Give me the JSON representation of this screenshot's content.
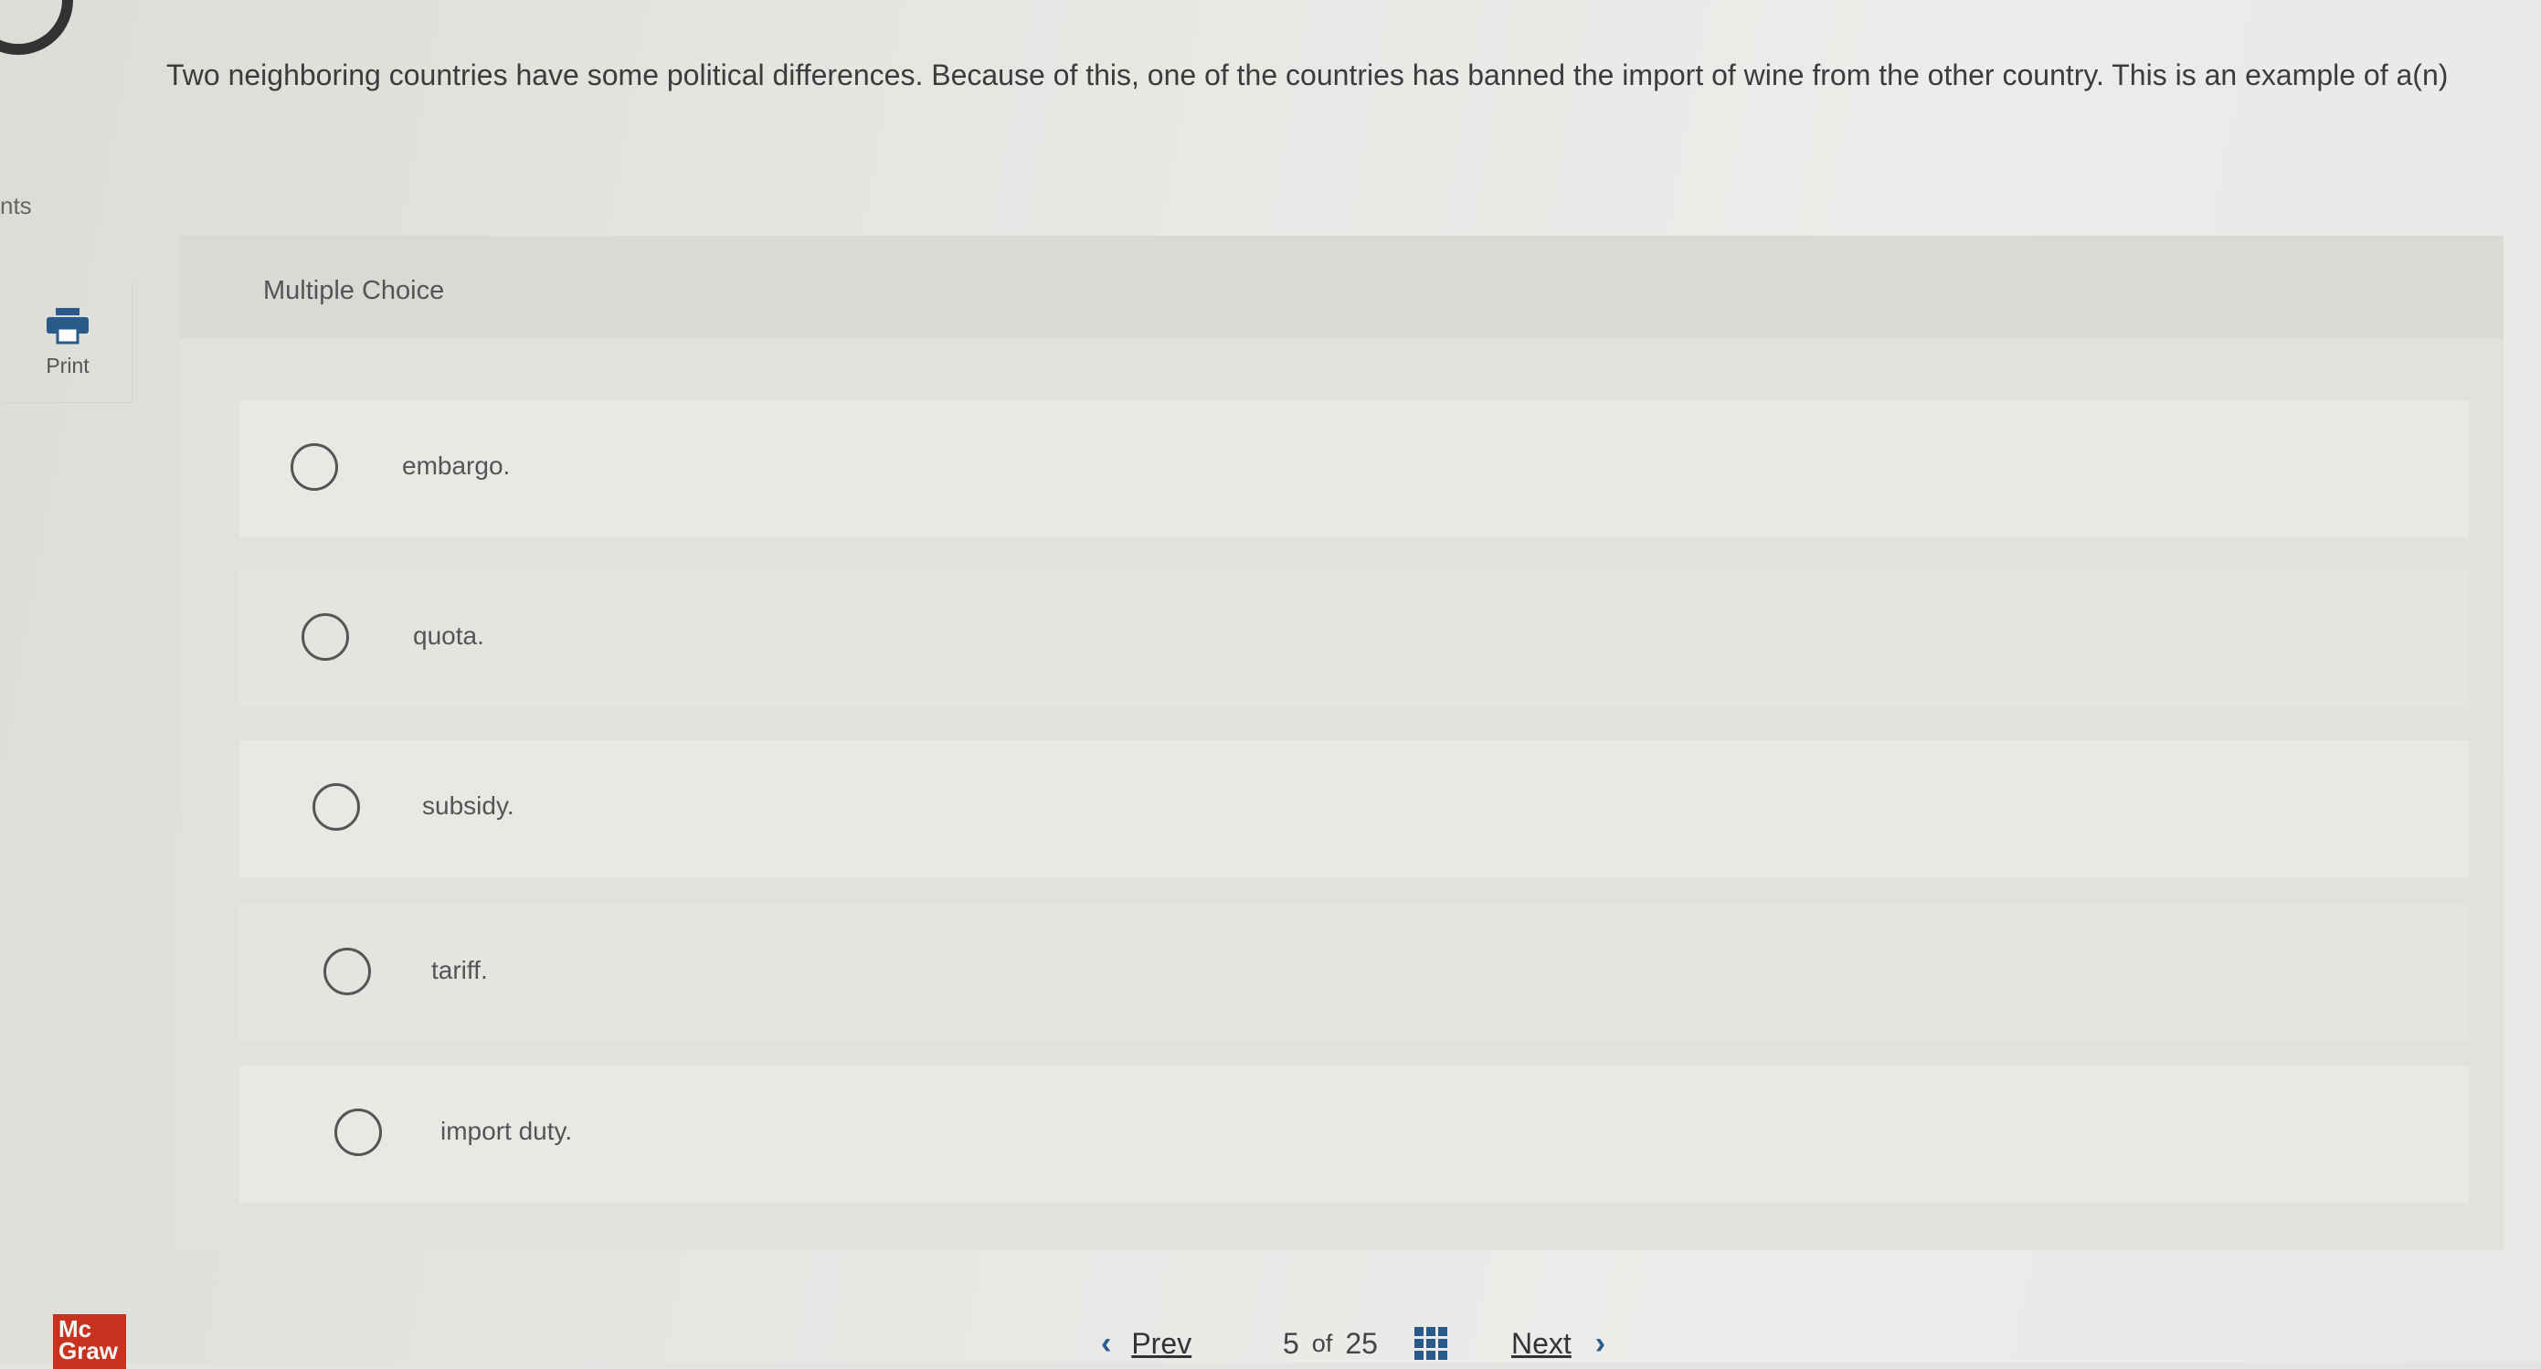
{
  "sidebar": {
    "nav_fragment": "nts",
    "print_label": "Print"
  },
  "question": {
    "text": "Two neighboring countries have some political differences. Because of this, one of the countries has banned the import of wine from the other country. This is an example of a(n)"
  },
  "multiple_choice": {
    "title": "Multiple Choice",
    "choices": [
      {
        "label": "embargo."
      },
      {
        "label": "quota."
      },
      {
        "label": "subsidy."
      },
      {
        "label": "tariff."
      },
      {
        "label": "import duty."
      }
    ]
  },
  "footer": {
    "logo_line1": "Mc",
    "logo_line2": "Graw",
    "prev_label": "Prev",
    "current_page": "5",
    "of_label": "of",
    "total_pages": "25",
    "next_label": "Next"
  },
  "colors": {
    "accent": "#2a5a8a",
    "logo": "#c8321e",
    "background": "#e3e3e1"
  },
  "icons": [
    "loading-spinner-icon",
    "printer-icon",
    "chevron-left-icon",
    "grid-icon",
    "chevron-right-icon"
  ]
}
